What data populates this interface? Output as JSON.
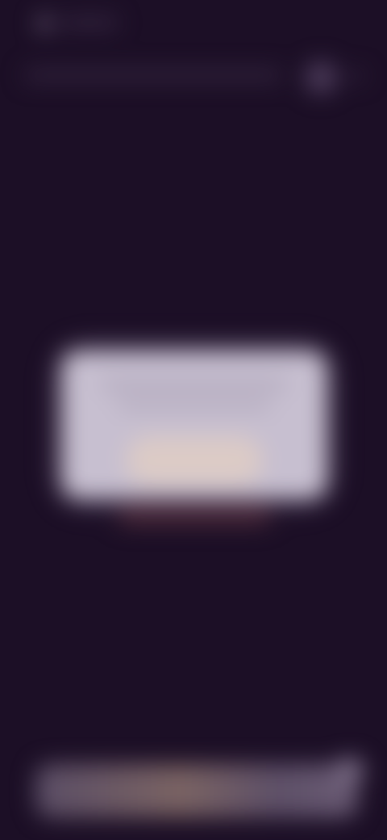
{
  "theme": {
    "background": "#1c0f26",
    "dialog_background": "#c7bfd0",
    "bottom_bar_accent": "#7a6363"
  },
  "status_bar": {
    "icon": "status-dot-icon"
  },
  "top_bar": {
    "menu_icon": "menu-icon"
  },
  "dialog": {},
  "bottom_bar": {}
}
